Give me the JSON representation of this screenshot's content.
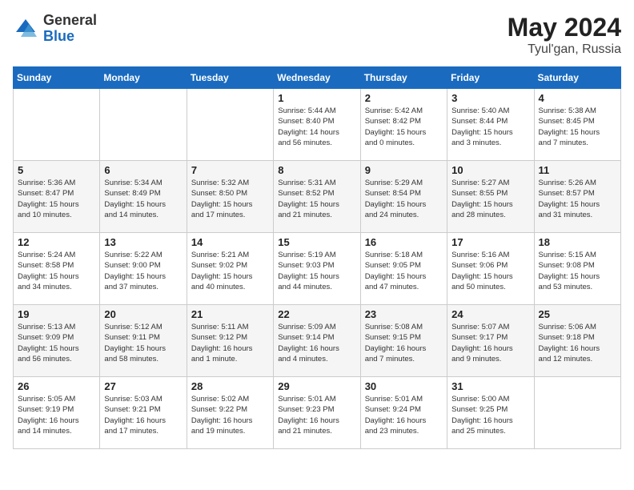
{
  "header": {
    "logo_general": "General",
    "logo_blue": "Blue",
    "month": "May 2024",
    "location": "Tyul'gan, Russia"
  },
  "days_of_week": [
    "Sunday",
    "Monday",
    "Tuesday",
    "Wednesday",
    "Thursday",
    "Friday",
    "Saturday"
  ],
  "weeks": [
    [
      {
        "day": "",
        "info": ""
      },
      {
        "day": "",
        "info": ""
      },
      {
        "day": "",
        "info": ""
      },
      {
        "day": "1",
        "info": "Sunrise: 5:44 AM\nSunset: 8:40 PM\nDaylight: 14 hours\nand 56 minutes."
      },
      {
        "day": "2",
        "info": "Sunrise: 5:42 AM\nSunset: 8:42 PM\nDaylight: 15 hours\nand 0 minutes."
      },
      {
        "day": "3",
        "info": "Sunrise: 5:40 AM\nSunset: 8:44 PM\nDaylight: 15 hours\nand 3 minutes."
      },
      {
        "day": "4",
        "info": "Sunrise: 5:38 AM\nSunset: 8:45 PM\nDaylight: 15 hours\nand 7 minutes."
      }
    ],
    [
      {
        "day": "5",
        "info": "Sunrise: 5:36 AM\nSunset: 8:47 PM\nDaylight: 15 hours\nand 10 minutes."
      },
      {
        "day": "6",
        "info": "Sunrise: 5:34 AM\nSunset: 8:49 PM\nDaylight: 15 hours\nand 14 minutes."
      },
      {
        "day": "7",
        "info": "Sunrise: 5:32 AM\nSunset: 8:50 PM\nDaylight: 15 hours\nand 17 minutes."
      },
      {
        "day": "8",
        "info": "Sunrise: 5:31 AM\nSunset: 8:52 PM\nDaylight: 15 hours\nand 21 minutes."
      },
      {
        "day": "9",
        "info": "Sunrise: 5:29 AM\nSunset: 8:54 PM\nDaylight: 15 hours\nand 24 minutes."
      },
      {
        "day": "10",
        "info": "Sunrise: 5:27 AM\nSunset: 8:55 PM\nDaylight: 15 hours\nand 28 minutes."
      },
      {
        "day": "11",
        "info": "Sunrise: 5:26 AM\nSunset: 8:57 PM\nDaylight: 15 hours\nand 31 minutes."
      }
    ],
    [
      {
        "day": "12",
        "info": "Sunrise: 5:24 AM\nSunset: 8:58 PM\nDaylight: 15 hours\nand 34 minutes."
      },
      {
        "day": "13",
        "info": "Sunrise: 5:22 AM\nSunset: 9:00 PM\nDaylight: 15 hours\nand 37 minutes."
      },
      {
        "day": "14",
        "info": "Sunrise: 5:21 AM\nSunset: 9:02 PM\nDaylight: 15 hours\nand 40 minutes."
      },
      {
        "day": "15",
        "info": "Sunrise: 5:19 AM\nSunset: 9:03 PM\nDaylight: 15 hours\nand 44 minutes."
      },
      {
        "day": "16",
        "info": "Sunrise: 5:18 AM\nSunset: 9:05 PM\nDaylight: 15 hours\nand 47 minutes."
      },
      {
        "day": "17",
        "info": "Sunrise: 5:16 AM\nSunset: 9:06 PM\nDaylight: 15 hours\nand 50 minutes."
      },
      {
        "day": "18",
        "info": "Sunrise: 5:15 AM\nSunset: 9:08 PM\nDaylight: 15 hours\nand 53 minutes."
      }
    ],
    [
      {
        "day": "19",
        "info": "Sunrise: 5:13 AM\nSunset: 9:09 PM\nDaylight: 15 hours\nand 56 minutes."
      },
      {
        "day": "20",
        "info": "Sunrise: 5:12 AM\nSunset: 9:11 PM\nDaylight: 15 hours\nand 58 minutes."
      },
      {
        "day": "21",
        "info": "Sunrise: 5:11 AM\nSunset: 9:12 PM\nDaylight: 16 hours\nand 1 minute."
      },
      {
        "day": "22",
        "info": "Sunrise: 5:09 AM\nSunset: 9:14 PM\nDaylight: 16 hours\nand 4 minutes."
      },
      {
        "day": "23",
        "info": "Sunrise: 5:08 AM\nSunset: 9:15 PM\nDaylight: 16 hours\nand 7 minutes."
      },
      {
        "day": "24",
        "info": "Sunrise: 5:07 AM\nSunset: 9:17 PM\nDaylight: 16 hours\nand 9 minutes."
      },
      {
        "day": "25",
        "info": "Sunrise: 5:06 AM\nSunset: 9:18 PM\nDaylight: 16 hours\nand 12 minutes."
      }
    ],
    [
      {
        "day": "26",
        "info": "Sunrise: 5:05 AM\nSunset: 9:19 PM\nDaylight: 16 hours\nand 14 minutes."
      },
      {
        "day": "27",
        "info": "Sunrise: 5:03 AM\nSunset: 9:21 PM\nDaylight: 16 hours\nand 17 minutes."
      },
      {
        "day": "28",
        "info": "Sunrise: 5:02 AM\nSunset: 9:22 PM\nDaylight: 16 hours\nand 19 minutes."
      },
      {
        "day": "29",
        "info": "Sunrise: 5:01 AM\nSunset: 9:23 PM\nDaylight: 16 hours\nand 21 minutes."
      },
      {
        "day": "30",
        "info": "Sunrise: 5:01 AM\nSunset: 9:24 PM\nDaylight: 16 hours\nand 23 minutes."
      },
      {
        "day": "31",
        "info": "Sunrise: 5:00 AM\nSunset: 9:25 PM\nDaylight: 16 hours\nand 25 minutes."
      },
      {
        "day": "",
        "info": ""
      }
    ]
  ]
}
